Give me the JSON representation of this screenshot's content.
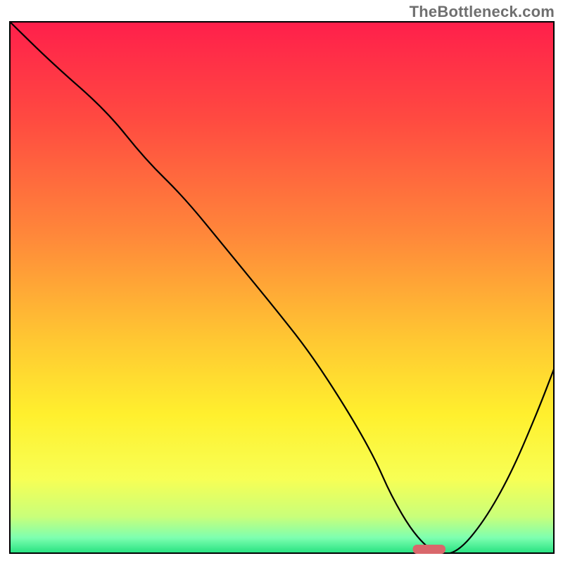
{
  "watermark": "TheBottleneck.com",
  "colors": {
    "curve": "#000000",
    "border": "#000000",
    "marker_fill": "#d9676b",
    "gradient_stops": [
      {
        "offset": 0.0,
        "color": "#ff1f4b"
      },
      {
        "offset": 0.18,
        "color": "#ff4941"
      },
      {
        "offset": 0.4,
        "color": "#ff873a"
      },
      {
        "offset": 0.6,
        "color": "#ffc832"
      },
      {
        "offset": 0.74,
        "color": "#fff02e"
      },
      {
        "offset": 0.86,
        "color": "#f7ff55"
      },
      {
        "offset": 0.93,
        "color": "#c9ff7a"
      },
      {
        "offset": 0.97,
        "color": "#7dffb0"
      },
      {
        "offset": 1.0,
        "color": "#22e07e"
      }
    ]
  },
  "chart_data": {
    "type": "line",
    "title": "",
    "xlabel": "",
    "ylabel": "",
    "xlim": [
      0,
      100
    ],
    "ylim": [
      0,
      100
    ],
    "x": [
      0,
      8,
      18,
      25,
      32,
      40,
      48,
      55,
      62,
      67,
      70,
      74,
      78,
      82,
      87,
      92,
      97,
      100
    ],
    "values": [
      100,
      92,
      83,
      74,
      67,
      57,
      47,
      38,
      27,
      18,
      11,
      4,
      0,
      0,
      6,
      15,
      27,
      35
    ],
    "marker": {
      "x_start": 74,
      "x_end": 80,
      "y": 0
    },
    "annotations": []
  }
}
